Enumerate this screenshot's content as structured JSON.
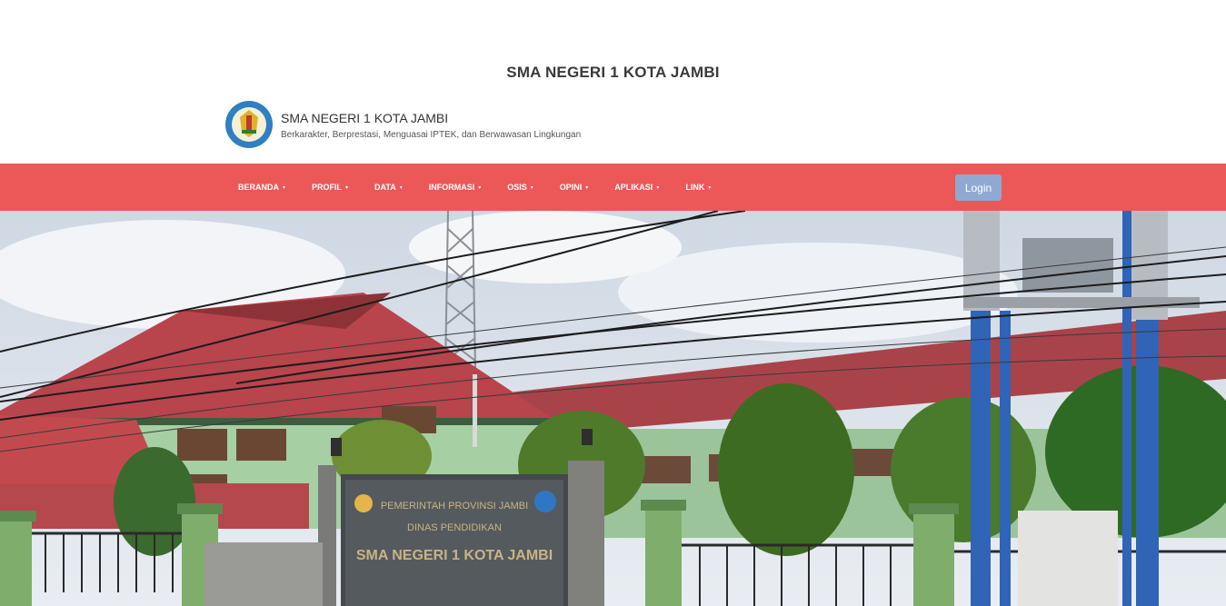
{
  "header": {
    "title": "SMA NEGERI 1 KOTA JAMBI",
    "school_name": "SMA NEGERI 1 KOTA JAMBI",
    "tagline": "Berkarakter, Berprestasi, Menguasai IPTEK, dan Berwawasan Lingkungan"
  },
  "nav": {
    "items": [
      {
        "label": "BERANDA"
      },
      {
        "label": "PROFIL"
      },
      {
        "label": "DATA"
      },
      {
        "label": "INFORMASI"
      },
      {
        "label": "OSIS"
      },
      {
        "label": "OPINI"
      },
      {
        "label": "APLIKASI"
      },
      {
        "label": "LINK"
      }
    ],
    "login_label": "Login"
  },
  "hero": {
    "sign_line1": "PEMERINTAH PROVINSI JAMBI",
    "sign_line2": "DINAS PENDIDIKAN",
    "sign_line3": "SMA NEGERI 1 KOTA JAMBI"
  },
  "colors": {
    "navbar": "#ec5758",
    "login_button": "#8fa9d4"
  }
}
